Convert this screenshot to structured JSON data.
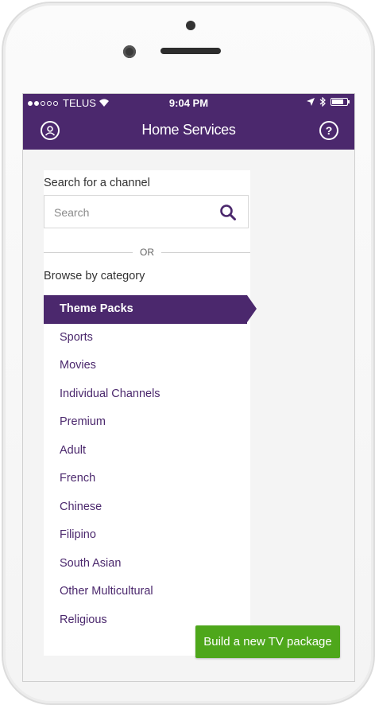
{
  "status_bar": {
    "carrier": "TELUS",
    "time": "9:04 PM"
  },
  "header": {
    "title": "Home Services",
    "help_symbol": "?"
  },
  "search": {
    "label": "Search for a channel",
    "placeholder": "Search"
  },
  "divider_text": "OR",
  "browse_label": "Browse by category",
  "categories": [
    {
      "label": "Theme Packs",
      "active": true
    },
    {
      "label": "Sports",
      "active": false
    },
    {
      "label": "Movies",
      "active": false
    },
    {
      "label": "Individual Channels",
      "active": false
    },
    {
      "label": "Premium",
      "active": false
    },
    {
      "label": "Adult",
      "active": false
    },
    {
      "label": "French",
      "active": false
    },
    {
      "label": "Chinese",
      "active": false
    },
    {
      "label": "Filipino",
      "active": false
    },
    {
      "label": "South Asian",
      "active": false
    },
    {
      "label": "Other Multicultural",
      "active": false
    },
    {
      "label": "Religious",
      "active": false
    }
  ],
  "cta": {
    "label": "Build a new TV package"
  },
  "colors": {
    "brand_purple": "#4b286d",
    "cta_green": "#4ea71b"
  }
}
